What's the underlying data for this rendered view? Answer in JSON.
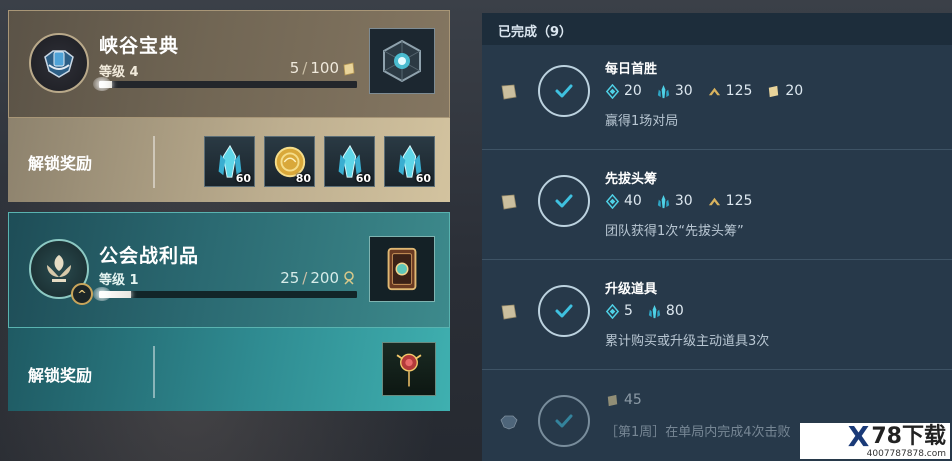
{
  "left": {
    "cards": [
      {
        "title": "峡谷宝典",
        "level": "等级 4",
        "progress_current": "5",
        "progress_sep": "/",
        "progress_max": "100",
        "progress_fraction": 0.05,
        "unlock_label": "解锁奖励",
        "rewards": [
          {
            "icon": "crystal-icon",
            "count": "60"
          },
          {
            "icon": "gold-coin-icon",
            "count": "80"
          },
          {
            "icon": "crystal-icon",
            "count": "60"
          },
          {
            "icon": "crystal-icon",
            "count": "60"
          }
        ]
      },
      {
        "title": "公会战利品",
        "level": "等级 1",
        "progress_current": "25",
        "progress_sep": "/",
        "progress_max": "200",
        "progress_fraction": 0.125,
        "unlock_label": "解锁奖励",
        "rank_badge": "^"
      }
    ]
  },
  "right": {
    "header": "已完成（9）",
    "missions": [
      {
        "title": "每日首胜",
        "rewards": [
          {
            "icon": "blue-gem-icon",
            "value": "20"
          },
          {
            "icon": "crystal-icon",
            "value": "30"
          },
          {
            "icon": "gold-chevron-icon",
            "value": "125"
          },
          {
            "icon": "scroll-ticket-icon",
            "value": "20"
          }
        ],
        "desc": "赢得1场对局"
      },
      {
        "title": "先拔头筹",
        "rewards": [
          {
            "icon": "blue-gem-icon",
            "value": "40"
          },
          {
            "icon": "crystal-icon",
            "value": "30"
          },
          {
            "icon": "gold-chevron-icon",
            "value": "125"
          }
        ],
        "desc": "团队获得1次“先拔头筹”"
      },
      {
        "title": "升级道具",
        "rewards": [
          {
            "icon": "blue-gem-icon",
            "value": "5"
          },
          {
            "icon": "crystal-icon",
            "value": "80"
          }
        ],
        "desc": "累计购买或升级主动道具3次"
      },
      {
        "title": "",
        "rewards": [
          {
            "icon": "scroll-ticket-icon",
            "value": "45"
          }
        ],
        "desc": "［第1周］在单局内完成4次击败"
      }
    ]
  },
  "watermark": {
    "brand": "78下载",
    "url": "4007787878.com"
  },
  "colors": {
    "gold_card": "#847661",
    "teal_card": "#2b6a72",
    "panel_bg": "#27394a",
    "accent_cyan": "#4fd1e6",
    "accent_gold": "#d9b35e"
  }
}
